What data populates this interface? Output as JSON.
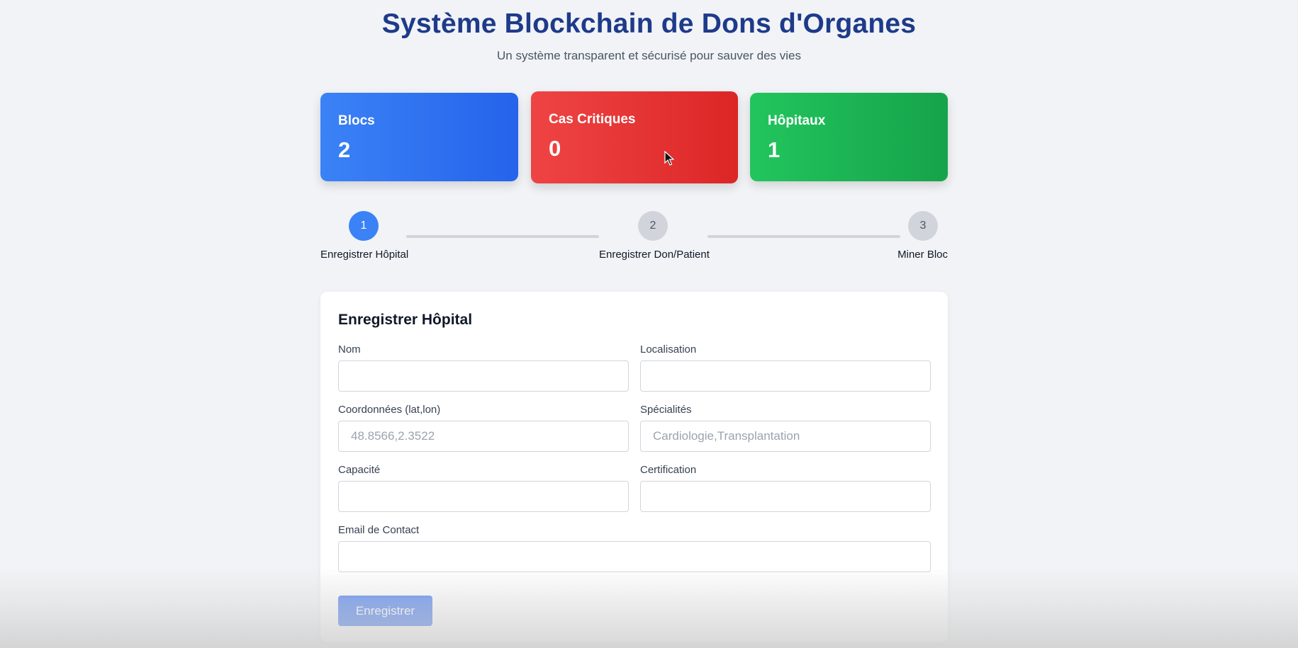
{
  "header": {
    "title": "Système Blockchain de Dons d'Organes",
    "subtitle": "Un système transparent et sécurisé pour sauver des vies"
  },
  "stats": {
    "blocks": {
      "label": "Blocs",
      "value": "2"
    },
    "critical": {
      "label": "Cas Critiques",
      "value": "0"
    },
    "hospitals": {
      "label": "Hôpitaux",
      "value": "1"
    }
  },
  "steps": [
    {
      "number": "1",
      "label": "Enregistrer Hôpital",
      "active": true
    },
    {
      "number": "2",
      "label": "Enregistrer Don/Patient",
      "active": false
    },
    {
      "number": "3",
      "label": "Miner Bloc",
      "active": false
    }
  ],
  "form": {
    "title": "Enregistrer Hôpital",
    "fields": {
      "name": {
        "label": "Nom",
        "value": "",
        "placeholder": ""
      },
      "location": {
        "label": "Localisation",
        "value": "",
        "placeholder": ""
      },
      "coordinates": {
        "label": "Coordonnées (lat,lon)",
        "value": "",
        "placeholder": "48.8566,2.3522"
      },
      "specialties": {
        "label": "Spécialités",
        "value": "",
        "placeholder": "Cardiologie,Transplantation"
      },
      "capacity": {
        "label": "Capacité",
        "value": "",
        "placeholder": ""
      },
      "certification": {
        "label": "Certification",
        "value": "",
        "placeholder": ""
      },
      "email": {
        "label": "Email de Contact",
        "value": "",
        "placeholder": ""
      }
    },
    "submit_label": "Enregistrer"
  },
  "colors": {
    "title": "#1e3a8a",
    "blue_card": "#2563eb",
    "red_card": "#dc2626",
    "green_card": "#16a34a",
    "active_step": "#3b82f6",
    "inactive_step": "#d1d5db",
    "submit_button": "#2563eb"
  }
}
